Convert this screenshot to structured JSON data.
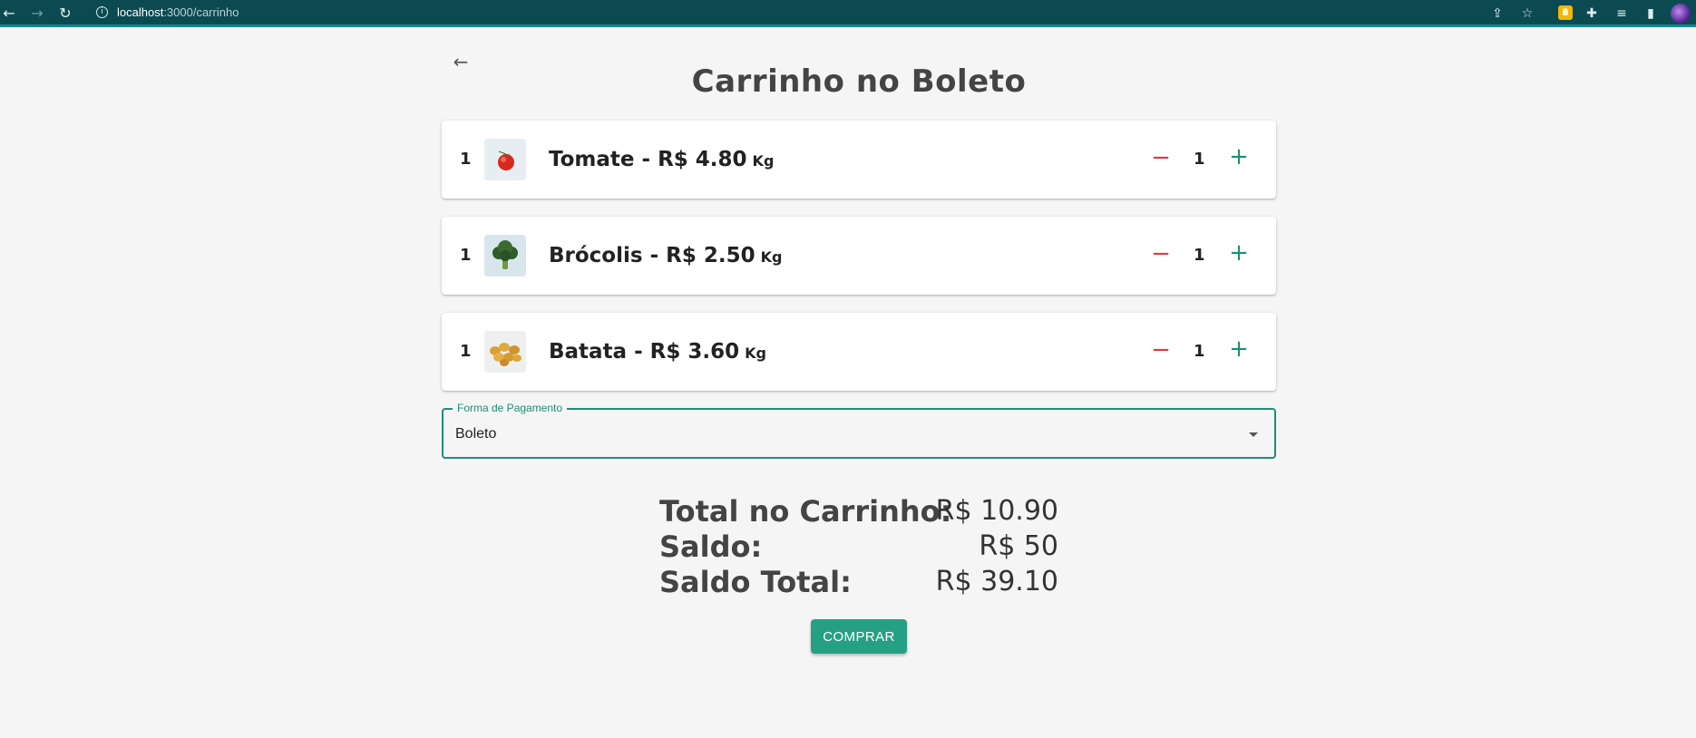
{
  "browser": {
    "url_host": "localhost",
    "url_path": ":3000/carrinho"
  },
  "page": {
    "title": "Carrinho no Boleto"
  },
  "cart": {
    "items": [
      {
        "index": "1",
        "name": "Tomate - R$ 4.80",
        "unit": "Kg",
        "quantity": "1",
        "image": "tomato"
      },
      {
        "index": "1",
        "name": "Brócolis - R$ 2.50",
        "unit": "Kg",
        "quantity": "1",
        "image": "broccoli"
      },
      {
        "index": "1",
        "name": "Batata - R$ 3.60",
        "unit": "Kg",
        "quantity": "1",
        "image": "potato"
      }
    ],
    "minus_symbol": "−",
    "plus_symbol": "+"
  },
  "payment": {
    "label": "Forma de Pagamento",
    "selected": "Boleto"
  },
  "totals": {
    "cart_total_label": "Total no Carrinho:",
    "cart_total_value": "R$ 10.90",
    "balance_label": "Saldo:",
    "balance_value": "R$ 50",
    "final_balance_label": "Saldo Total:",
    "final_balance_value": "R$ 39.10"
  },
  "actions": {
    "buy_label": "COMPRAR"
  },
  "colors": {
    "primary": "#26a084",
    "minus": "#e53935",
    "chrome": "#0c4a52"
  }
}
